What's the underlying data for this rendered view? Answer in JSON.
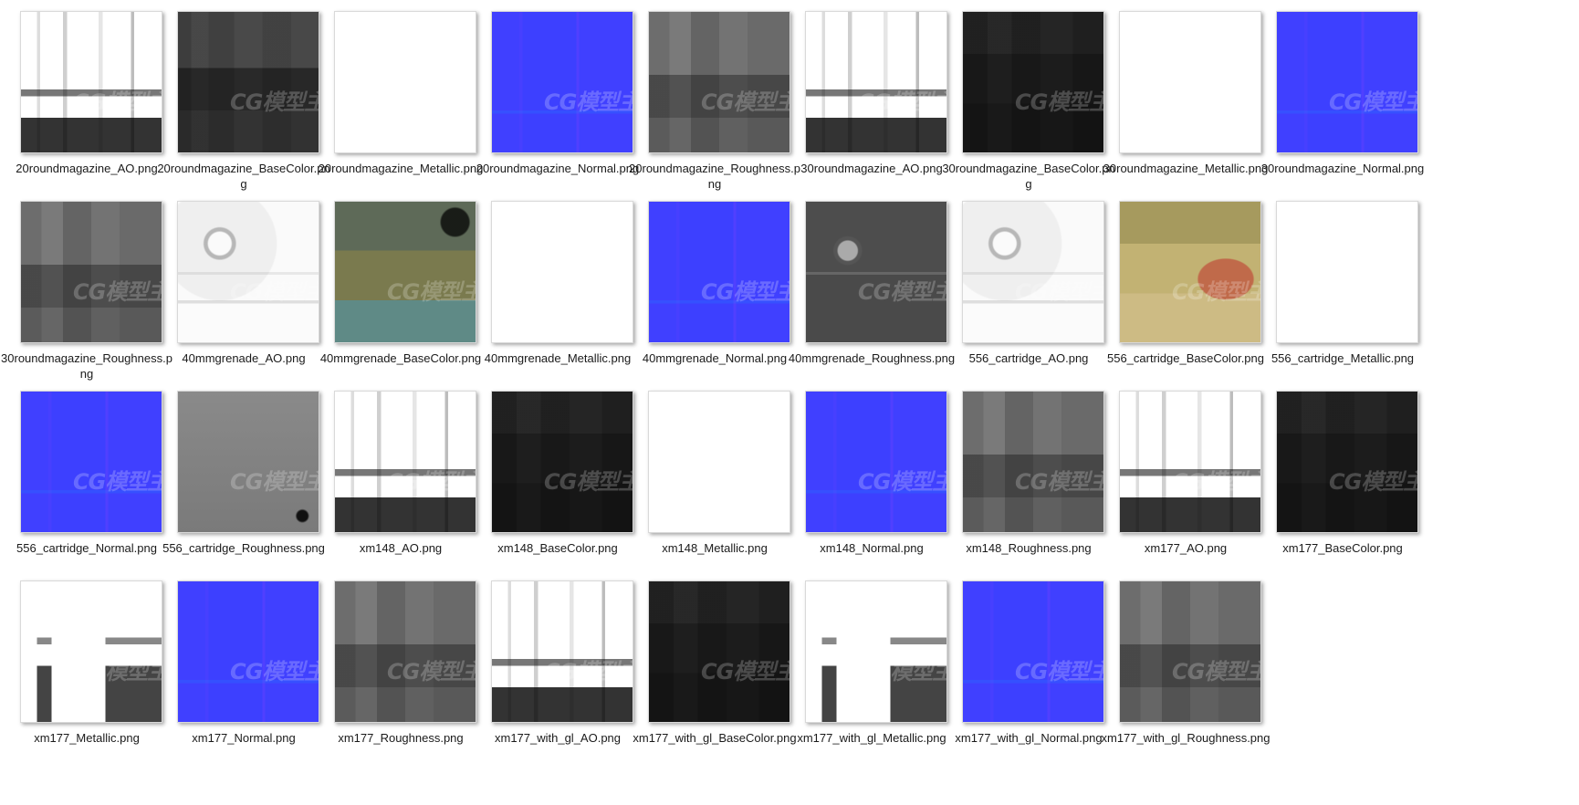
{
  "watermark": "CG模型主",
  "files": [
    {
      "name": "20roundmagazine_AO.png",
      "kind": "ao"
    },
    {
      "name": "20roundmagazine_BaseColor.png",
      "kind": "basecolor-gray"
    },
    {
      "name": "20roundmagazine_Metallic.png",
      "kind": "metallic-white"
    },
    {
      "name": "20roundmagazine_Normal.png",
      "kind": "normal"
    },
    {
      "name": "20roundmagazine_Roughness.png",
      "kind": "roughness"
    },
    {
      "name": "30roundmagazine_AO.png",
      "kind": "ao"
    },
    {
      "name": "30roundmagazine_BaseColor.png",
      "kind": "basecolor-dark"
    },
    {
      "name": "30roundmagazine_Metallic.png",
      "kind": "metallic-white"
    },
    {
      "name": "30roundmagazine_Normal.png",
      "kind": "normal"
    },
    {
      "name": "30roundmagazine_Roughness.png",
      "kind": "roughness"
    },
    {
      "name": "40mmgrenade_AO.png",
      "kind": "ao-light"
    },
    {
      "name": "40mmgrenade_BaseColor.png",
      "kind": "basecolor-olive"
    },
    {
      "name": "40mmgrenade_Metallic.png",
      "kind": "metallic-white"
    },
    {
      "name": "40mmgrenade_Normal.png",
      "kind": "normal"
    },
    {
      "name": "40mmgrenade_Roughness.png",
      "kind": "roughness-dark"
    },
    {
      "name": "556_cartridge_AO.png",
      "kind": "ao-light"
    },
    {
      "name": "556_cartridge_BaseColor.png",
      "kind": "basecolor-gold"
    },
    {
      "name": "556_cartridge_Metallic.png",
      "kind": "metallic-white"
    },
    {
      "name": "556_cartridge_Normal.png",
      "kind": "normal"
    },
    {
      "name": "556_cartridge_Roughness.png",
      "kind": "roughness-mid"
    },
    {
      "name": "xm148_AO.png",
      "kind": "ao"
    },
    {
      "name": "xm148_BaseColor.png",
      "kind": "basecolor-dark"
    },
    {
      "name": "xm148_Metallic.png",
      "kind": "metallic-white"
    },
    {
      "name": "xm148_Normal.png",
      "kind": "normal"
    },
    {
      "name": "xm148_Roughness.png",
      "kind": "roughness"
    },
    {
      "name": "xm177_AO.png",
      "kind": "ao"
    },
    {
      "name": "xm177_BaseColor.png",
      "kind": "basecolor-dark"
    },
    {
      "name": "xm177_Metallic.png",
      "kind": "metallic-bw"
    },
    {
      "name": "xm177_Normal.png",
      "kind": "normal"
    },
    {
      "name": "xm177_Roughness.png",
      "kind": "roughness"
    },
    {
      "name": "xm177_with_gl_AO.png",
      "kind": "ao"
    },
    {
      "name": "xm177_with_gl_BaseColor.png",
      "kind": "basecolor-dark"
    },
    {
      "name": "xm177_with_gl_Metallic.png",
      "kind": "metallic-bw"
    },
    {
      "name": "xm177_with_gl_Normal.png",
      "kind": "normal"
    },
    {
      "name": "xm177_with_gl_Roughness.png",
      "kind": "roughness"
    }
  ]
}
